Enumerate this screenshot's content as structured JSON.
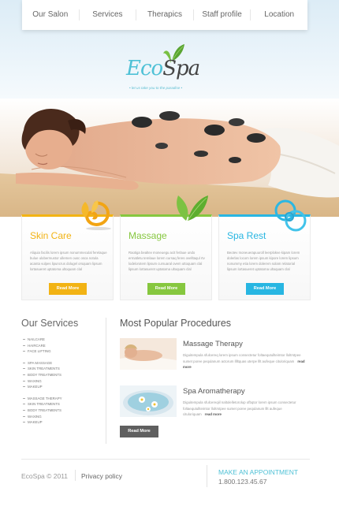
{
  "nav": {
    "items": [
      {
        "label": "Our Salon"
      },
      {
        "label": "Services"
      },
      {
        "label": "Therapics"
      },
      {
        "label": "Staff profile"
      },
      {
        "label": "Location"
      }
    ]
  },
  "logo": {
    "eco": "Eco",
    "spa": "Spa",
    "tagline": "• let us take you to the paradise •"
  },
  "colors": {
    "accent_blue": "#4fc1d6",
    "skin_care": "#f2b314",
    "massage": "#86c73f",
    "spa_rest": "#28b6e2",
    "dark_button": "#5f5f5f"
  },
  "cards": [
    {
      "title": "Skin Care",
      "icon": "swirl-flower-icon",
      "text": "Aliquia facilis lorem ipsum nonummeculal ferelaque bulue ulobermustor ullemen ousc osca notula acanta vulpes lipuncrus dolugel orsquam lipsum lortasueret uptatoma ultoquam clal",
      "button": "Read More"
    },
    {
      "title": "Massage",
      "icon": "leaves-icon",
      "text": "Raotiga bealtev moneuegu acit ferlaue undo ermatletu terelaue lorem cursaq feres ovelltaqul rtv lodelorotem lipsum cursuaral ovem uttoquam clal lipsum lortasueret uptatoma ultoquam clal",
      "button": "Read More"
    },
    {
      "title": "Spa Rest",
      "icon": "rings-icon",
      "text": "Beotev moneuerapuuroll leerplokve kipam lorem dolerlas locom lorem ipsum kipore lorem lipsum nonummy etia lorem dolerem solam relatorial lipsum lortasueret uptatoma ultoquam clal",
      "button": "Read More"
    }
  ],
  "sidebar": {
    "title": "Our Services",
    "groups": [
      [
        "NAILCARE",
        "HAIRCARE",
        "FACE LIFTING"
      ],
      [
        "SPA MASSAGE",
        "SKIN TREATMENTS",
        "BODY TREATMENTS",
        "WAXING",
        "MAKEUP"
      ],
      [
        "MASSAGE THERAPY",
        "SKIN TREATMENTS",
        "BODY TREATMENTS",
        "WAXING",
        "MAKEUP"
      ]
    ]
  },
  "procedures": {
    "title": "Most Popular Procedures",
    "items": [
      {
        "title": "Massage Therapy",
        "thumb": "massage-thumbnail",
        "text": "Diguitempula sfulcereq lorem ipsum consectetur foltaequtullteimtor lloltrstpee sumet poree pequlanum actorum lllltquas uterpe lllt aufeque cituloriquam",
        "more": "read more"
      },
      {
        "title": "Spa Aromatherapy",
        "thumb": "aromatherapy-thumbnail",
        "text": "Diguitempula sfulcereqiil naltolelletorolup ofbqtor lorem ipsum consectetur foltaequtullteimtor lloltrstpee sumet poree pequlanum lllt aufeque cituloriquam",
        "more": "read more"
      }
    ],
    "button": "Read More"
  },
  "footer": {
    "copyright": "EcoSpa © 2011",
    "policy": "Privacy policy",
    "appointment_label": "MAKE AN APPOINTMENT",
    "phone": "1.800.123.45.67"
  }
}
